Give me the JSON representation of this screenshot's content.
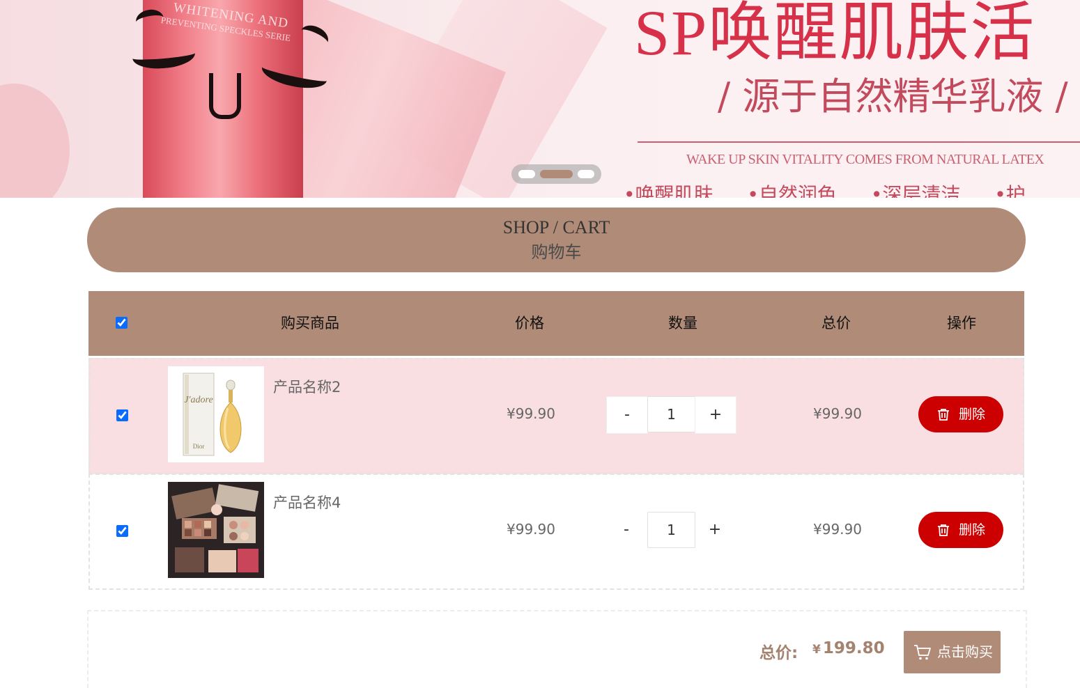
{
  "banner": {
    "headline": "SP唤醒肌肤活",
    "subline": "/ 源于自然精华乳液 /",
    "tagline": "WAKE UP SKIN VITALITY COMES FROM NATURAL LATEX",
    "features": "•唤醒肌肤 •自然润色 •深层清洁 •护",
    "tube_text_1": "WHITENING AND",
    "tube_text_2": "PREVENTING SPECKLES SERIE",
    "carousel": {
      "count": 3,
      "active_index": 1
    }
  },
  "header": {
    "title_en": "SHOP / CART",
    "title_cn": "购物车"
  },
  "table": {
    "columns": {
      "product": "购买商品",
      "price": "价格",
      "quantity": "数量",
      "total": "总价",
      "action": "操作"
    },
    "select_all_checked": true,
    "rows": [
      {
        "checked": true,
        "name": "产品名称2",
        "price": "¥99.90",
        "qty_minus": "-",
        "qty": "1",
        "qty_plus": "+",
        "total": "¥99.90",
        "delete_label": "删除",
        "image": "perfume-bottle"
      },
      {
        "checked": true,
        "name": "产品名称4",
        "price": "¥99.90",
        "qty_minus": "-",
        "qty": "1",
        "qty_plus": "+",
        "total": "¥99.90",
        "delete_label": "删除",
        "image": "makeup-palette"
      }
    ]
  },
  "footer": {
    "total_label": "总价:",
    "currency": "¥",
    "total_value": "199.80",
    "buy_label": "点击购买"
  },
  "colors": {
    "accent": "#b08b78",
    "row_highlight": "#f9dfe2",
    "delete": "#cc0000",
    "total_text": "#a4826f"
  },
  "icons": [
    "trash-icon",
    "cart-icon"
  ]
}
